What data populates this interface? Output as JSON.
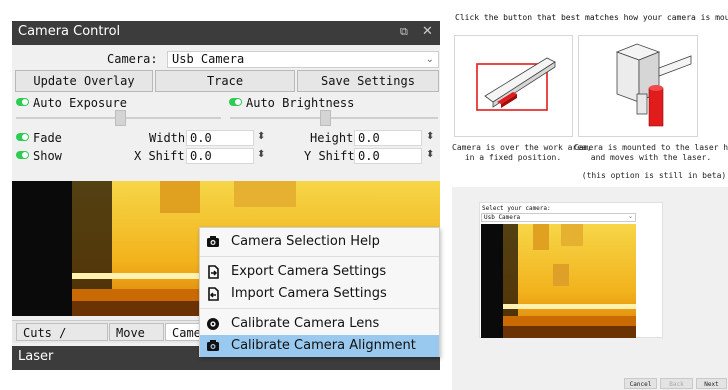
{
  "camera_control": {
    "title": "Camera Control",
    "camera_label": "Camera:",
    "camera_value": "Usb Camera",
    "buttons": {
      "update_overlay": "Update Overlay",
      "trace": "Trace",
      "save_settings": "Save Settings"
    },
    "auto_exposure": "Auto Exposure",
    "auto_brightness": "Auto Brightness",
    "fade": "Fade",
    "show": "Show",
    "width_label": "Width",
    "width_value": "0.0",
    "height_label": "Height",
    "height_value": "0.0",
    "xshift_label": "X Shift",
    "xshift_value": "0.0",
    "yshift_label": "Y Shift",
    "yshift_value": "0.0",
    "tabs": [
      "Cuts / L···",
      "Move",
      "Came"
    ]
  },
  "laser_panel": {
    "title": "Laser"
  },
  "context_menu": {
    "items": [
      "Camera Selection Help",
      "Export Camera Settings",
      "Import Camera Settings",
      "Calibrate Camera Lens",
      "Calibrate Camera Alignment"
    ],
    "highlighted_index": 4,
    "highlight_color": "#99c9ef"
  },
  "help": {
    "instruction": "Click the button that best matches how your camera is mounted:",
    "option1_caption": "Camera is over the work area,\nin a fixed position.",
    "option2_caption": "Camera is mounted to the laser head,\nand moves with the laser.",
    "option2_note": "(this option is still in beta)"
  },
  "wizard": {
    "select_label": "Select your camera:",
    "select_value": "Usb Camera",
    "buttons": {
      "cancel": "Cancel",
      "back": "Back",
      "next": "Next"
    }
  },
  "colors": {
    "titlebar": "#3c3c3c",
    "toggle_on": "#2ecc55",
    "accent_red": "#e21c1c"
  }
}
